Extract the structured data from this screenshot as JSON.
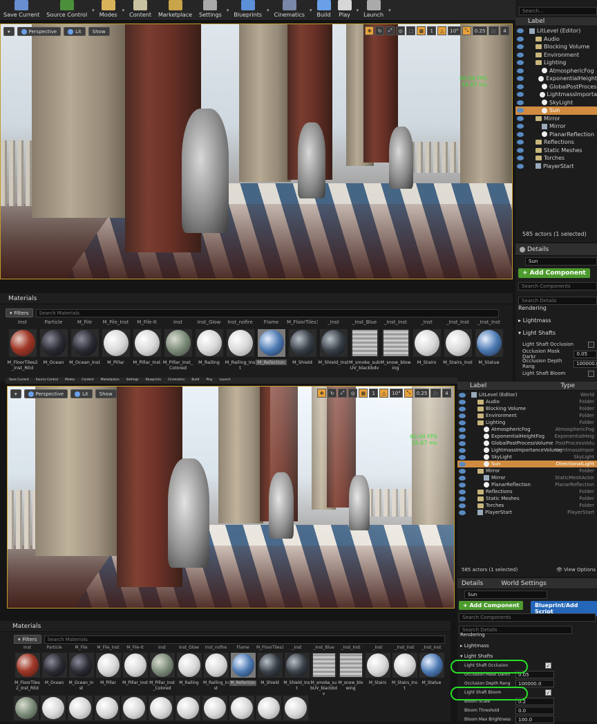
{
  "toolbar": {
    "buttons": [
      "Save Current",
      "Source Control",
      "Modes",
      "Content",
      "Marketplace",
      "Settings",
      "Blueprints",
      "Cinematics",
      "Build",
      "Play",
      "Launch"
    ]
  },
  "viewport": {
    "menu_caret": "▾",
    "perspective": "Perspective",
    "lit": "Lit",
    "show": "Show",
    "grid_snap": "1",
    "rot_snap": "10°",
    "scale_snap": "0.25",
    "cam_speed": "4",
    "fps": "60.00 FPS",
    "ms": "16.67 ms"
  },
  "outliner": {
    "search_placeholder": "Search...",
    "col_label": "Label",
    "col_type": "Type",
    "items": [
      {
        "label": "LitLevel (Editor)",
        "type": "World",
        "indent": 0,
        "icon": "world"
      },
      {
        "label": "Audio",
        "type": "Folder",
        "indent": 1,
        "icon": "folder"
      },
      {
        "label": "Blocking Volume",
        "type": "Folder",
        "indent": 1,
        "icon": "folder"
      },
      {
        "label": "Environment",
        "type": "Folder",
        "indent": 1,
        "icon": "folder"
      },
      {
        "label": "Lighting",
        "type": "Folder",
        "indent": 1,
        "icon": "folder"
      },
      {
        "label": "AtmosphericFog",
        "type": "AtmosphericFog",
        "indent": 2,
        "icon": "light"
      },
      {
        "label": "ExponentialHeightFog",
        "type": "ExponentialHeig",
        "indent": 2,
        "icon": "light"
      },
      {
        "label": "GlobalPostProcessVolume",
        "type": "PostProcessVolu",
        "indent": 2,
        "icon": "light"
      },
      {
        "label": "LightmassImportanceVolume",
        "type": "LightmassImpor",
        "indent": 2,
        "icon": "light"
      },
      {
        "label": "SkyLight",
        "type": "SkyLight",
        "indent": 2,
        "icon": "light"
      },
      {
        "label": "Sun",
        "type": "DirectionalLight",
        "indent": 2,
        "icon": "light",
        "selected": true
      },
      {
        "label": "Mirror",
        "type": "Folder",
        "indent": 1,
        "icon": "folder"
      },
      {
        "label": "Mirror",
        "type": "StaticMeshActor",
        "indent": 2,
        "icon": "mesh"
      },
      {
        "label": "PlanarReflection",
        "type": "PlanarReflection",
        "indent": 2,
        "icon": "light"
      },
      {
        "label": "Reflections",
        "type": "Folder",
        "indent": 1,
        "icon": "folder"
      },
      {
        "label": "Static Meshes",
        "type": "Folder",
        "indent": 1,
        "icon": "folder"
      },
      {
        "label": "Torches",
        "type": "Folder",
        "indent": 1,
        "icon": "folder"
      },
      {
        "label": "PlayerStart",
        "type": "PlayerStart",
        "indent": 1,
        "icon": "mesh"
      }
    ],
    "actors_count": "585 actors (1 selected)",
    "view_options": "View Options"
  },
  "outliner_top_short": [
    "LitLevel (Editor)",
    "Audio",
    "Blocking Volume",
    "Environment",
    "Lighting",
    "AtmosphericFog",
    "ExponentialHeight",
    "GlobalPostProces",
    "LightmassImporta",
    "SkyLight",
    "Sun",
    "Mirror",
    "Mirror",
    "PlanarReflection",
    "Reflections",
    "Static Meshes",
    "Torches",
    "PlayerStart"
  ],
  "details": {
    "tab": "Details",
    "world_settings_tab": "World Settings",
    "name_value": "Sun",
    "add_component": "+ Add Component",
    "blueprint_btn": "Blueprint/Add Script",
    "search_components": "Search Components",
    "search_details": "Search Details",
    "cat_rendering": "Rendering",
    "cat_lightmass": "Lightmass",
    "cat_light_shafts": "Light Shafts",
    "props": [
      {
        "label": "Light Shaft Occlusion",
        "value": "",
        "kind": "check"
      },
      {
        "label": "Occlusion Mask Darkness",
        "value": "0.05",
        "kind": "num"
      },
      {
        "label": "Occlusion Depth Range",
        "value": "100000.0",
        "kind": "num"
      },
      {
        "label": "Light Shaft Bloom",
        "value": "",
        "kind": "check"
      }
    ],
    "props_top_labels": [
      "Light Shaft Occlusion",
      "Occlusion Mask Darkr",
      "Occlusion Depth Rang",
      "Light Shaft Bloom"
    ],
    "props_top_values": [
      "",
      "0.05",
      "100000.0",
      ""
    ],
    "props_bottom": [
      {
        "label": "Light Shaft Occlusion",
        "value": "",
        "kind": "check"
      },
      {
        "label": "Occlusion Mask Darkn",
        "value": "0.05",
        "kind": "num"
      },
      {
        "label": "Occlusion Depth Rang",
        "value": "100000.0",
        "kind": "num"
      },
      {
        "label": "Light Shaft Bloom",
        "value": "",
        "kind": "check"
      },
      {
        "label": "Bloom Scale",
        "value": "0.2",
        "kind": "num"
      },
      {
        "label": "Bloom Threshold",
        "value": "0.0",
        "kind": "num"
      },
      {
        "label": "Bloom Max Brightness",
        "value": "100.0",
        "kind": "num"
      }
    ]
  },
  "materials": {
    "title": "Materials",
    "filters": "Filters",
    "search_placeholder": "Search Materials",
    "top_labels": [
      "Inst",
      "Particle",
      "M_File",
      "M_File_Inst",
      "M_File-It",
      "Inst",
      "Inst_Glow",
      "Inst_nofire",
      "Flame",
      "M_FloorTiles1",
      "_Inst",
      "_Inst_Blue",
      "_Inst_Inst",
      "_Inst",
      "_Inst_Inst",
      "_Inst_Inst"
    ],
    "items": [
      {
        "name": "M_FloorTiles2_Inst_REd",
        "ball": "red"
      },
      {
        "name": "M_Ocean",
        "ball": "dark"
      },
      {
        "name": "M_Ocean_Inst",
        "ball": "dark"
      },
      {
        "name": "M_Pillar",
        "ball": "white"
      },
      {
        "name": "M_Pillar_Inst",
        "ball": "white"
      },
      {
        "name": "M_Pillar_Inst_Colored",
        "ball": "green"
      },
      {
        "name": "M_Railing",
        "ball": "white"
      },
      {
        "name": "M_Railing_Inst",
        "ball": "white"
      },
      {
        "name": "M_Refection",
        "ball": "blue",
        "selected": true
      },
      {
        "name": "M_Shield",
        "ball": "black"
      },
      {
        "name": "M_Shield_Inst",
        "ball": "black"
      },
      {
        "name": "M_smoke_subUV_blackbdv",
        "ball": "grid"
      },
      {
        "name": "M_snow_blowing",
        "ball": "grid"
      },
      {
        "name": "M_Stairs",
        "ball": "white"
      },
      {
        "name": "M_Stairs_Inst",
        "ball": "white"
      },
      {
        "name": "M_Statue",
        "ball": "blue"
      }
    ]
  },
  "colors": {
    "selection": "#d08b40",
    "add_component": "#4d9b2e",
    "blueprint": "#2466b8",
    "highlight_ring": "#28e028",
    "fps": "#3ddc3d"
  }
}
